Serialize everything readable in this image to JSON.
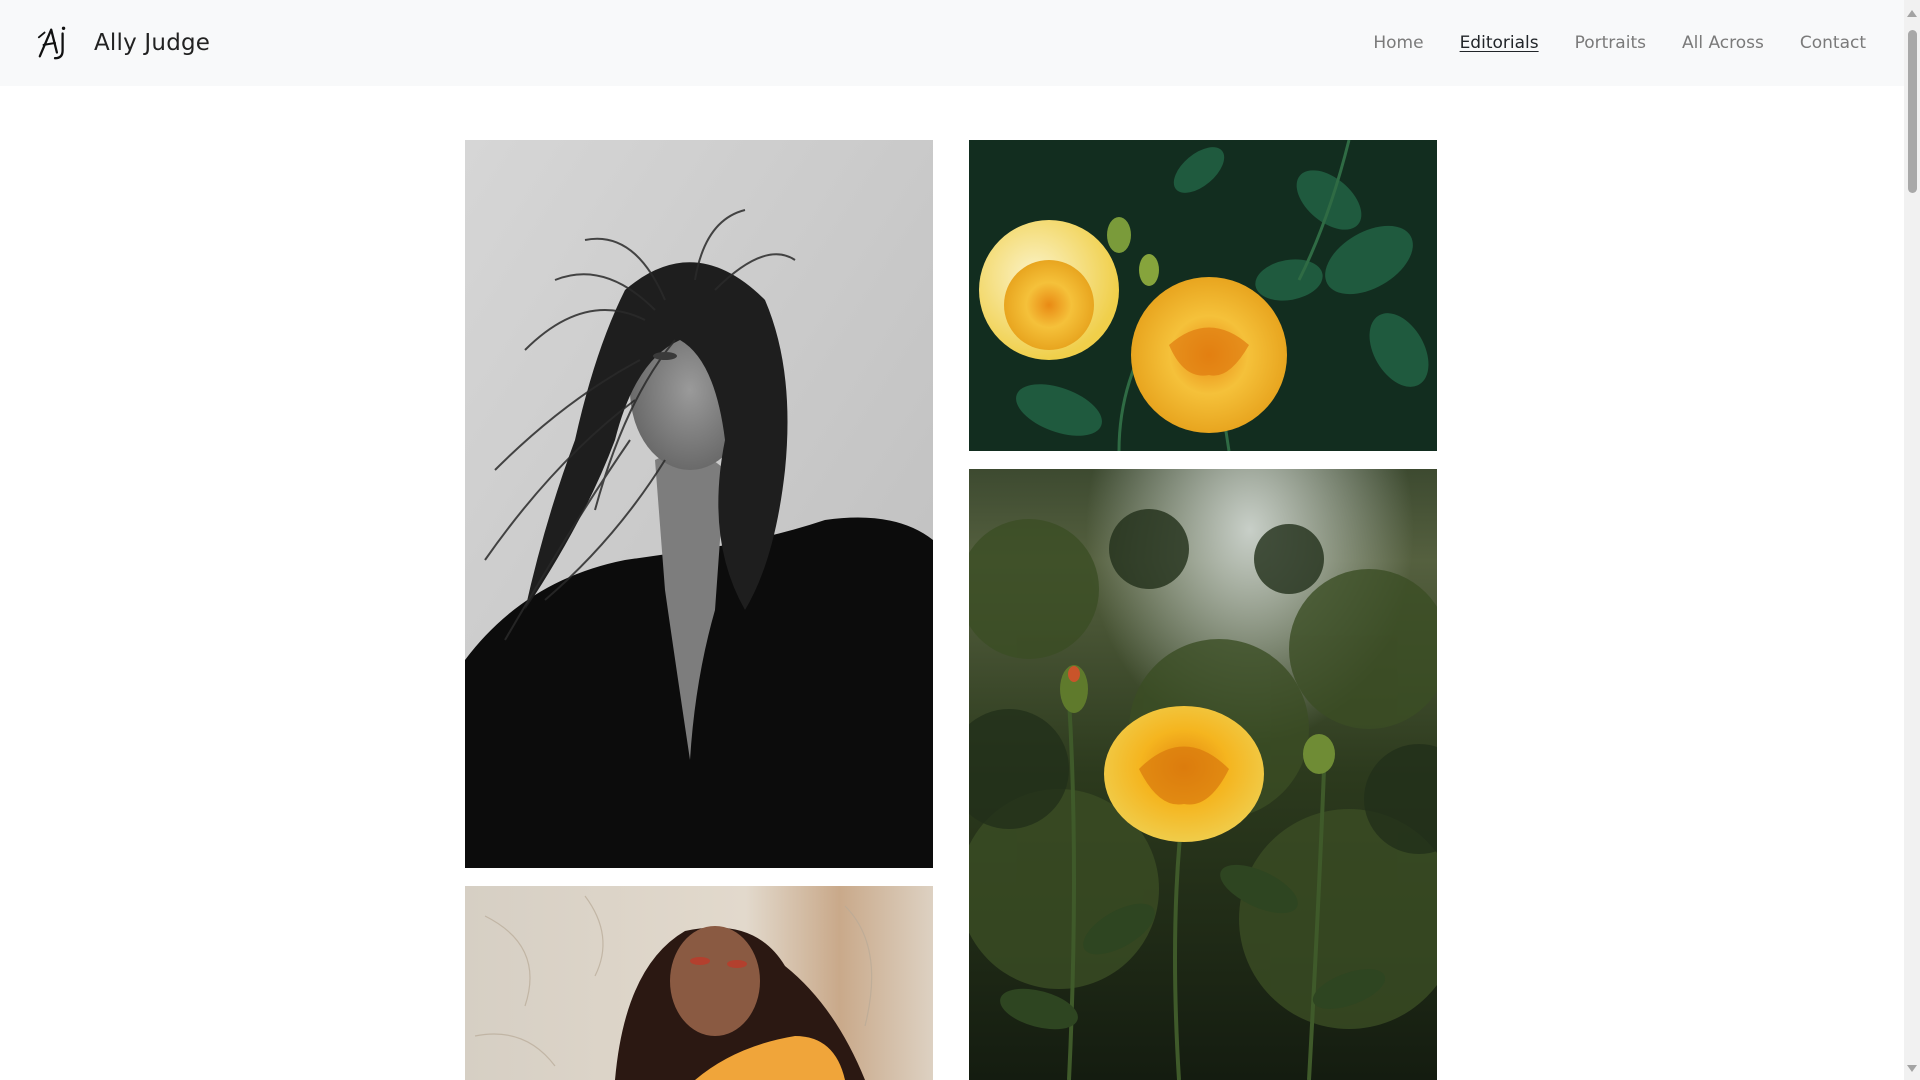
{
  "header": {
    "logo_text": "AJ",
    "brand_name": "Ally Judge"
  },
  "nav": {
    "items": [
      {
        "label": "Home",
        "active": false
      },
      {
        "label": "Editorials",
        "active": true
      },
      {
        "label": "Portraits",
        "active": false
      },
      {
        "label": "All Across",
        "active": false
      },
      {
        "label": "Contact",
        "active": false
      }
    ]
  },
  "gallery": {
    "photos": [
      {
        "name": "photo-bw-portrait-wind-hair"
      },
      {
        "name": "photo-yellow-roses-pair"
      },
      {
        "name": "photo-yellow-rose-garden"
      },
      {
        "name": "photo-woman-orange-top"
      }
    ]
  },
  "colors": {
    "header_bg": "#f8f9fa",
    "nav_text": "#7a7a7a",
    "nav_active": "#212529"
  }
}
